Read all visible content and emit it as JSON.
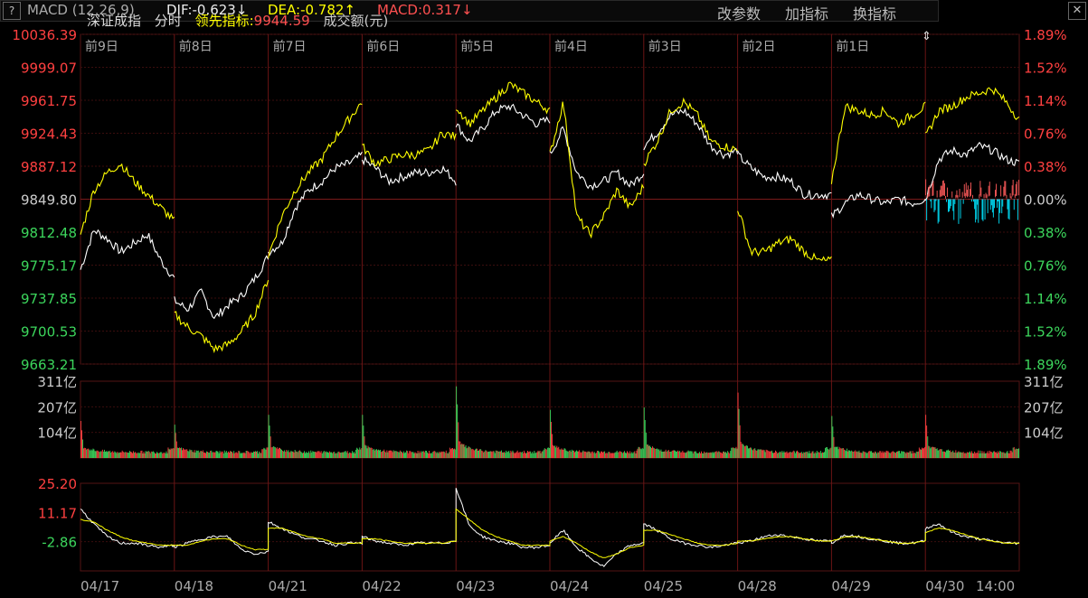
{
  "header": {
    "index_name": "深证成指",
    "mode": "分时",
    "lead_label": "领先指标:",
    "lead_value": "9944.59",
    "volume_label": "成交额(元)"
  },
  "macd_bar": {
    "help_label": "?",
    "name": "MACD (12,26,9)",
    "dif": "DIF:-0.623↓",
    "dea": "DEA:-0.782↑",
    "macd": "MACD:0.317↓",
    "btn_params": "改参数",
    "btn_add": "加指标",
    "btn_switch": "换指标",
    "btn_close": "✕"
  },
  "colors": {
    "up": "#ff4040",
    "down": "#3cd65c",
    "price": "#ffffff",
    "lead": "#ffff00",
    "macd_pos": "#ff5a5a",
    "macd_neg": "#00e5ff",
    "grid": "#3a0d0d"
  },
  "chart_data": [
    {
      "type": "line",
      "panel": "price",
      "base": 9849.8,
      "y_labels_left": [
        "10036.39",
        "9999.07",
        "9961.75",
        "9924.43",
        "9887.12",
        "9849.80",
        "9812.48",
        "9775.17",
        "9737.85",
        "9700.53",
        "9663.21"
      ],
      "y_labels_right": [
        "1.89%",
        "1.52%",
        "1.14%",
        "0.76%",
        "0.38%",
        "0.00%",
        "0.38%",
        "0.76%",
        "1.14%",
        "1.52%",
        "1.89%"
      ],
      "ylim": [
        9663.21,
        10036.39
      ],
      "day_labels": [
        "前9日",
        "前8日",
        "前7日",
        "前6日",
        "前5日",
        "前4日",
        "前3日",
        "前2日",
        "前1日"
      ],
      "series": [
        {
          "key": "price",
          "values": [
            [
              9770,
              9815,
              9805,
              9790,
              9800,
              9810,
              9780,
              9760
            ],
            [
              9735,
              9725,
              9745,
              9715,
              9730,
              9740,
              9760,
              9785
            ],
            [
              9790,
              9800,
              9840,
              9860,
              9870,
              9885,
              9890,
              9900
            ],
            [
              9895,
              9885,
              9870,
              9875,
              9880,
              9880,
              9885,
              9870
            ],
            [
              9935,
              9915,
              9930,
              9950,
              9955,
              9945,
              9935,
              9940
            ],
            [
              9900,
              9930,
              9880,
              9865,
              9870,
              9880,
              9865,
              9880
            ],
            [
              9910,
              9925,
              9945,
              9950,
              9935,
              9910,
              9900,
              9905
            ],
            [
              9900,
              9885,
              9875,
              9875,
              9870,
              9855,
              9855,
              9855
            ],
            [
              9830,
              9845,
              9855,
              9850,
              9845,
              9850,
              9845,
              9850
            ],
            [
              9850,
              9895,
              9905,
              9900,
              9910,
              9905,
              9895,
              9890
            ]
          ]
        },
        {
          "key": "lead",
          "values": [
            [
              9810,
              9860,
              9880,
              9890,
              9870,
              9855,
              9840,
              9825
            ],
            [
              9720,
              9705,
              9695,
              9680,
              9685,
              9700,
              9720,
              9760
            ],
            [
              9785,
              9830,
              9860,
              9880,
              9895,
              9920,
              9940,
              9960
            ],
            [
              9910,
              9890,
              9895,
              9900,
              9900,
              9905,
              9925,
              9920
            ],
            [
              9955,
              9935,
              9950,
              9965,
              9980,
              9970,
              9960,
              9950
            ],
            [
              9900,
              9960,
              9830,
              9810,
              9830,
              9860,
              9840,
              9865
            ],
            [
              9890,
              9915,
              9950,
              9960,
              9945,
              9915,
              9910,
              9905
            ],
            [
              9840,
              9790,
              9790,
              9800,
              9805,
              9790,
              9780,
              9780
            ],
            [
              9870,
              9955,
              9950,
              9945,
              9950,
              9935,
              9945,
              9955
            ],
            [
              9920,
              9950,
              9955,
              9965,
              9970,
              9975,
              9960,
              9940
            ]
          ]
        }
      ]
    },
    {
      "type": "bar",
      "panel": "volume",
      "y_labels": [
        "311亿",
        "207亿",
        "104亿"
      ],
      "unit": "亿",
      "ylim": [
        0,
        311
      ],
      "day_spikes": [
        150,
        135,
        175,
        175,
        290,
        195,
        205,
        265,
        170,
        175
      ]
    },
    {
      "type": "area",
      "panel": "macd",
      "y_labels": [
        "25.20",
        "11.17",
        "-2.86"
      ],
      "ylim": [
        -14,
        27
      ],
      "x_labels": [
        "04/17",
        "04/18",
        "04/21",
        "04/22",
        "04/23",
        "04/24",
        "04/25",
        "04/28",
        "04/29",
        "04/30",
        "14:00"
      ],
      "series": [
        {
          "key": "dif",
          "values": [
            [
              15,
              8,
              2,
              -1,
              -1,
              -2,
              -3,
              -2
            ],
            [
              -3,
              -1,
              1,
              2,
              2,
              -4,
              -6,
              -5
            ],
            [
              9,
              6,
              3,
              1,
              0,
              -2,
              -1,
              -1
            ],
            [
              2,
              0,
              -1,
              -2,
              -1,
              -1,
              -1,
              0
            ],
            [
              25,
              7,
              2,
              0,
              -1,
              -3,
              -3,
              -2
            ],
            [
              -1,
              5,
              -3,
              -8,
              -12,
              -6,
              -2,
              -1
            ],
            [
              8,
              5,
              1,
              -1,
              -2,
              -3,
              -2,
              -1
            ],
            [
              -1,
              0,
              2,
              3,
              2,
              1,
              0,
              0
            ],
            [
              -1,
              3,
              2,
              1,
              0,
              -1,
              -1,
              0
            ],
            [
              6,
              8,
              4,
              2,
              1,
              0,
              -1,
              -1
            ]
          ]
        },
        {
          "key": "dea",
          "values": [
            [
              10,
              9,
              5,
              2,
              0,
              -1,
              -2,
              -2
            ],
            [
              -2,
              -2,
              0,
              1,
              1,
              -2,
              -4,
              -4
            ],
            [
              6,
              6,
              4,
              2,
              1,
              -1,
              -1,
              -1
            ],
            [
              1,
              1,
              0,
              -1,
              -1,
              -1,
              -1,
              0
            ],
            [
              15,
              10,
              5,
              2,
              0,
              -2,
              -2,
              -2
            ],
            [
              0,
              2,
              -1,
              -5,
              -8,
              -6,
              -3,
              -2
            ],
            [
              5,
              5,
              3,
              1,
              -1,
              -2,
              -2,
              -1
            ],
            [
              0,
              0,
              1,
              2,
              2,
              1,
              0,
              0
            ],
            [
              0,
              2,
              2,
              1,
              0,
              -1,
              -1,
              0
            ],
            [
              4,
              6,
              5,
              3,
              1,
              0,
              -1,
              -1
            ]
          ]
        }
      ]
    }
  ]
}
